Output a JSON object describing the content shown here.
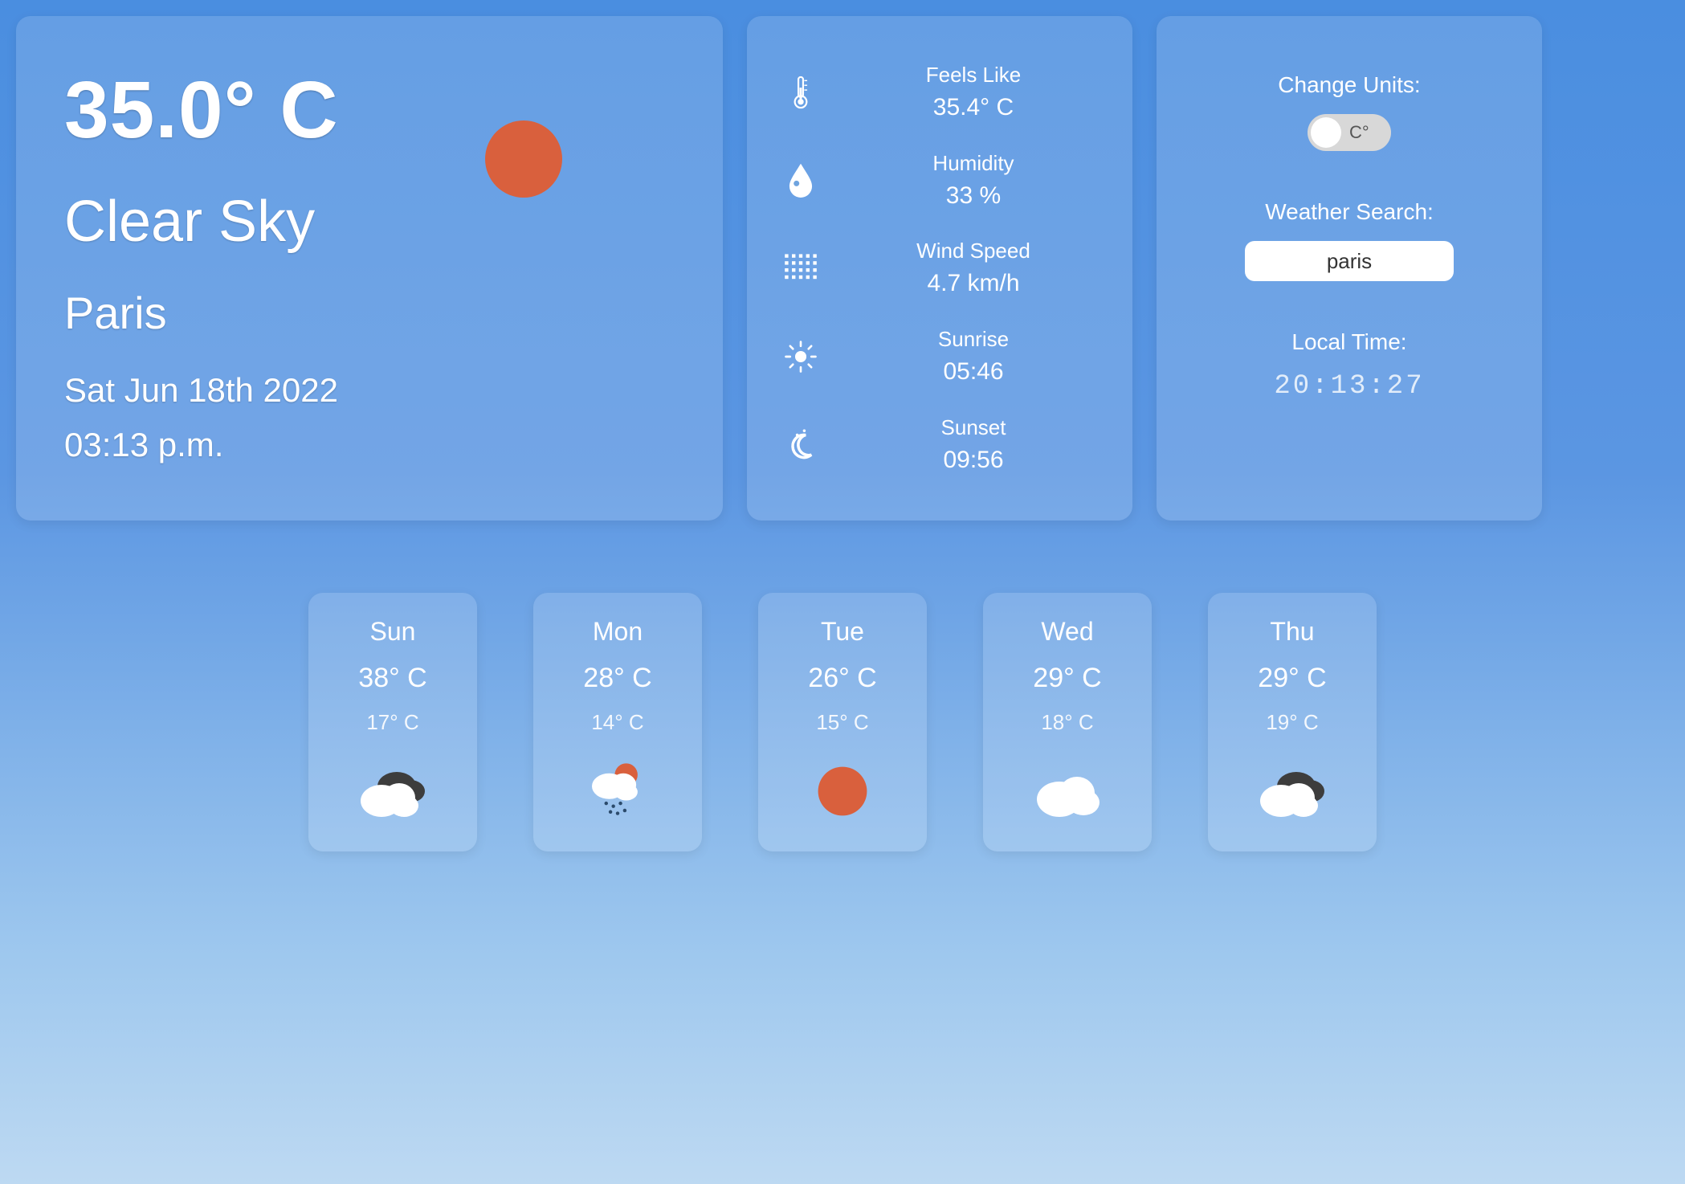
{
  "current": {
    "temperature": "35.0° C",
    "description": "Clear Sky",
    "city": "Paris",
    "date": "Sat Jun 18th 2022",
    "time": "03:13 p.m.",
    "icon": "sun"
  },
  "details": {
    "feels_like": {
      "label": "Feels Like",
      "value": "35.4° C",
      "icon": "thermometer"
    },
    "humidity": {
      "label": "Humidity",
      "value": "33 %",
      "icon": "droplet"
    },
    "wind": {
      "label": "Wind Speed",
      "value": "4.7 km/h",
      "icon": "wind-grid"
    },
    "sunrise": {
      "label": "Sunrise",
      "value": "05:46",
      "icon": "sunrise"
    },
    "sunset": {
      "label": "Sunset",
      "value": "09:56",
      "icon": "sunset"
    }
  },
  "controls": {
    "units_label": "Change Units:",
    "units_toggle_text": "C°",
    "search_label": "Weather Search:",
    "search_value": "paris",
    "local_time_label": "Local Time:",
    "local_time_value": "20:13:27"
  },
  "forecast": [
    {
      "day": "Sun",
      "high": "38° C",
      "low": "17° C",
      "icon": "cloud-dark"
    },
    {
      "day": "Mon",
      "high": "28° C",
      "low": "14° C",
      "icon": "rain-sun"
    },
    {
      "day": "Tue",
      "high": "26° C",
      "low": "15° C",
      "icon": "sun"
    },
    {
      "day": "Wed",
      "high": "29° C",
      "low": "18° C",
      "icon": "cloud"
    },
    {
      "day": "Thu",
      "high": "29° C",
      "low": "19° C",
      "icon": "cloud-dark"
    }
  ]
}
